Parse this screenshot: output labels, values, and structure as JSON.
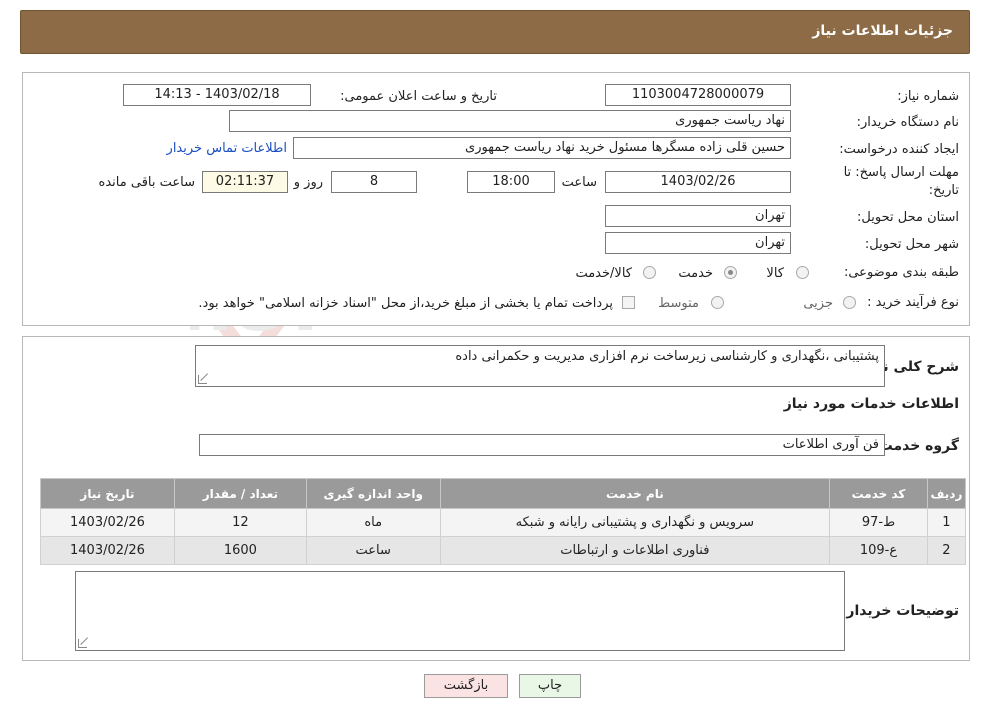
{
  "header": {
    "title": "جزئیات اطلاعات نیاز"
  },
  "need_info": {
    "need_number_label": "شماره نیاز:",
    "need_number": "1103004728000079",
    "announce_label": "تاریخ و ساعت اعلان عمومی:",
    "announce_value": "1403/02/18 - 14:13",
    "buyer_org_label": "نام دستگاه خریدار:",
    "buyer_org": "نهاد ریاست جمهوری",
    "creator_label": "ایجاد کننده درخواست:",
    "creator": "حسین قلی زاده مسگرها مسئول خرید نهاد ریاست جمهوری",
    "contact_link": "اطلاعات تماس خریدار",
    "deadline_label_line1": "مهلت ارسال پاسخ: تا",
    "deadline_label_line2": "تاریخ:",
    "deadline_date": "1403/02/26",
    "time_label": "ساعت",
    "deadline_time": "18:00",
    "days_value": "8",
    "days_label": "روز و",
    "remaining_time": "02:11:37",
    "remaining_label": "ساعت باقی مانده",
    "province_label": "استان محل تحویل:",
    "province": "تهران",
    "city_label": "شهر محل تحویل:",
    "city": "تهران",
    "category_label": "طبقه بندی موضوعی:",
    "category_options": [
      "کالا",
      "خدمت",
      "کالا/خدمت"
    ],
    "category_selected": "خدمت",
    "purchase_type_label": "نوع فرآیند خرید :",
    "purchase_options": [
      "جزیی",
      "متوسط"
    ],
    "purchase_selected": "",
    "payment_note": "پرداخت تمام یا بخشی از مبلغ خرید،از محل \"اسناد خزانه اسلامی\" خواهد بود."
  },
  "description": {
    "label": "شرح کلی نیاز:",
    "text": "پشتیبانی ،نگهداری و کارشناسی زیرساخت نرم افزاری مدیریت و حکمرانی داده"
  },
  "services": {
    "section_title": "اطلاعات خدمات مورد نیاز",
    "group_label": "گروه خدمت:",
    "group_value": "فن آوری اطلاعات",
    "columns": [
      "ردیف",
      "کد خدمت",
      "نام خدمت",
      "واحد اندازه گیری",
      "تعداد / مقدار",
      "تاریخ نیاز"
    ],
    "rows": [
      [
        "1",
        "ط-97",
        "سرویس و نگهداری و پشتیبانی رایانه و شبکه",
        "ماه",
        "12",
        "1403/02/26"
      ],
      [
        "2",
        "ع-109",
        "فناوری اطلاعات و ارتباطات",
        "ساعت",
        "1600",
        "1403/02/26"
      ]
    ]
  },
  "buyer_notes": {
    "label": "توضیحات خریدار:",
    "text": ""
  },
  "buttons": {
    "print": "چاپ",
    "back": "بازگشت"
  },
  "watermark": {
    "text": "AriaTender.neT"
  },
  "colors": {
    "header_bg": "#8c6b46",
    "table_header_bg": "#9a9a9a",
    "link": "#1a4fc4"
  }
}
